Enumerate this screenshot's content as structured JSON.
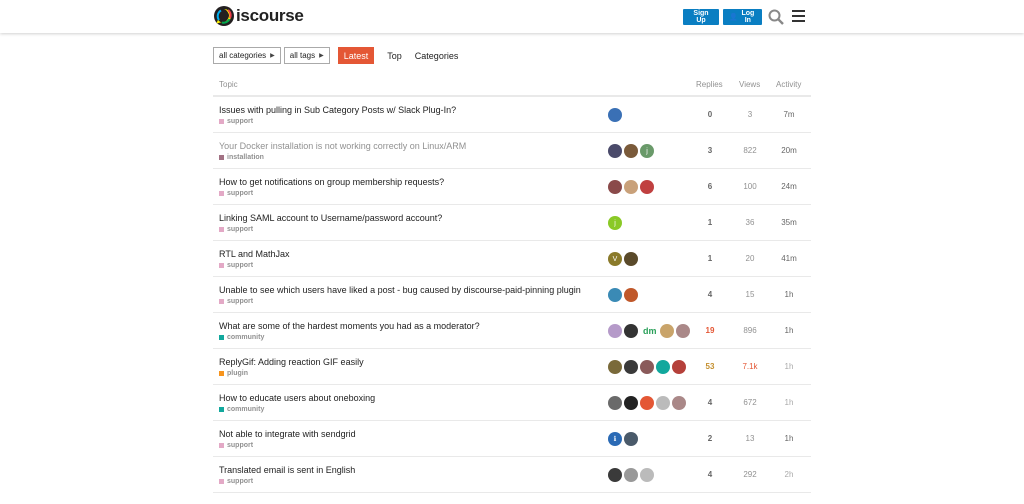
{
  "header": {
    "logo_text": "iscourse",
    "signup_label": "Sign Up",
    "login_label": "Log In"
  },
  "nav": {
    "categories_dd": "all categories",
    "tags_dd": "all tags",
    "tabs": [
      "Latest",
      "Top",
      "Categories"
    ],
    "active_tab": "Latest"
  },
  "columns": {
    "topic": "Topic",
    "replies": "Replies",
    "views": "Views",
    "activity": "Activity"
  },
  "colors": {
    "accent": "#e45735",
    "primary_button": "#0a7ec2",
    "support": "#e3a9c6",
    "installation": "#a27284",
    "community": "#12a89d",
    "plugin": "#f7941d"
  },
  "topics": [
    {
      "title": "Issues with pulling in Sub Category Posts w/ Slack Plug-In?",
      "category": "support",
      "cat_color": "#e3a9c6",
      "replies": "0",
      "views": "3",
      "activity": "7m",
      "visited": false,
      "avatars": [
        {
          "color": "#3a70b5",
          "label": ""
        }
      ]
    },
    {
      "title": "Your Docker installation is not working correctly on Linux/ARM",
      "category": "installation",
      "cat_color": "#a27284",
      "replies": "3",
      "views": "822",
      "activity": "20m",
      "visited": true,
      "avatars": [
        {
          "color": "#4a4a6a",
          "label": ""
        },
        {
          "color": "#7a5a3a",
          "label": ""
        },
        {
          "color": "#6a9a6a",
          "label": "j"
        }
      ]
    },
    {
      "title": "How to get notifications on group membership requests?",
      "category": "support",
      "cat_color": "#e3a9c6",
      "replies": "6",
      "views": "100",
      "activity": "24m",
      "visited": false,
      "avatars": [
        {
          "color": "#8a4a4a",
          "label": ""
        },
        {
          "color": "#c9a17a",
          "label": ""
        },
        {
          "color": "#c04040",
          "label": ""
        }
      ]
    },
    {
      "title": "Linking SAML account to Username/password account?",
      "category": "support",
      "cat_color": "#e3a9c6",
      "replies": "1",
      "views": "36",
      "activity": "35m",
      "visited": false,
      "avatars": [
        {
          "color": "#8ac926",
          "label": "j"
        }
      ]
    },
    {
      "title": "RTL and MathJax",
      "category": "support",
      "cat_color": "#e3a9c6",
      "replies": "1",
      "views": "20",
      "activity": "41m",
      "visited": false,
      "avatars": [
        {
          "color": "#8a7a2a",
          "label": "V"
        },
        {
          "color": "#5a4a2a",
          "label": ""
        }
      ]
    },
    {
      "title": "Unable to see which users have liked a post - bug caused by discourse-paid-pinning plugin",
      "category": "support",
      "cat_color": "#e3a9c6",
      "replies": "4",
      "views": "15",
      "activity": "1h",
      "visited": false,
      "avatars": [
        {
          "color": "#3a8ab5",
          "label": ""
        },
        {
          "color": "#c0582a",
          "label": ""
        }
      ]
    },
    {
      "title": "What are some of the hardest moments you had as a moderator?",
      "category": "community",
      "cat_color": "#12a89d",
      "replies": "19",
      "views": "896",
      "activity": "1h",
      "visited": false,
      "replies_class": "hot",
      "avatars": [
        {
          "color": "#b59ac9",
          "label": ""
        },
        {
          "color": "#333333",
          "label": ""
        },
        {
          "color": "",
          "label": "dm"
        },
        {
          "color": "#c9a46a",
          "label": ""
        },
        {
          "color": "#a88",
          "label": ""
        }
      ]
    },
    {
      "title": "ReplyGif: Adding reaction GIF easily",
      "category": "plugin",
      "cat_color": "#f7941d",
      "replies": "53",
      "views": "7.1k",
      "activity": "1h",
      "visited": false,
      "replies_class": "warm",
      "views_class": "hot",
      "activity_class": "faded",
      "avatars": [
        {
          "color": "#7a6a3a",
          "label": ""
        },
        {
          "color": "#3a3a3a",
          "label": ""
        },
        {
          "color": "#8a5a5a",
          "label": ""
        },
        {
          "color": "#12a89d",
          "label": ""
        },
        {
          "color": "#b5403a",
          "label": ""
        }
      ]
    },
    {
      "title": "How to educate users about oneboxing",
      "category": "community",
      "cat_color": "#12a89d",
      "replies": "4",
      "views": "672",
      "activity": "1h",
      "visited": false,
      "activity_class": "faded",
      "avatars": [
        {
          "color": "#6a6a6a",
          "label": ""
        },
        {
          "color": "#222222",
          "label": ""
        },
        {
          "color": "#e45735",
          "label": ""
        },
        {
          "color": "#bbbbbb",
          "label": ""
        },
        {
          "color": "#a88",
          "label": ""
        }
      ]
    },
    {
      "title": "Not able to integrate with sendgrid",
      "category": "support",
      "cat_color": "#e3a9c6",
      "replies": "2",
      "views": "13",
      "activity": "1h",
      "visited": false,
      "avatars": [
        {
          "color": "#2a6ab5",
          "label": "ℹ"
        },
        {
          "color": "#4a5a6a",
          "label": ""
        }
      ]
    },
    {
      "title": "Translated email is sent in English",
      "category": "support",
      "cat_color": "#e3a9c6",
      "replies": "4",
      "views": "292",
      "activity": "2h",
      "visited": false,
      "activity_class": "faded",
      "avatars": [
        {
          "color": "#3a3a3a",
          "label": ""
        },
        {
          "color": "#999999",
          "label": ""
        },
        {
          "color": "#bbbbbb",
          "label": ""
        }
      ]
    }
  ]
}
